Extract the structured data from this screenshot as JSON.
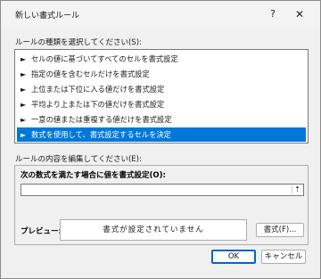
{
  "window": {
    "title": "新しい書式ルール",
    "help_glyph": "?",
    "close_glyph": "✕"
  },
  "rule_type": {
    "label": "ルールの種類を選択してください(S):",
    "items": [
      "セルの値に基づいてすべてのセルを書式設定",
      "指定の値を含むセルだけを書式設定",
      "上位または下位に入る値だけを書式設定",
      "平均より上または下の値だけを書式設定",
      "一意の値または重複する値だけを書式設定",
      "数式を使用して、書式設定するセルを決定"
    ],
    "selected_index": 5,
    "item_arrow": "►"
  },
  "rule_desc": {
    "label": "ルールの内容を編集してください(E):",
    "formula_label": "次の数式を満たす場合に値を書式設定(O):",
    "formula_value": "",
    "collapse_glyph": "⇡",
    "preview_label": "プレビュー:",
    "preview_text": "書式が設定されていません",
    "format_button": "書式(F)..."
  },
  "buttons": {
    "ok": "OK",
    "cancel": "キャンセル"
  },
  "colors": {
    "selection": "#0078d7",
    "default_button_border": "#0067c0"
  }
}
